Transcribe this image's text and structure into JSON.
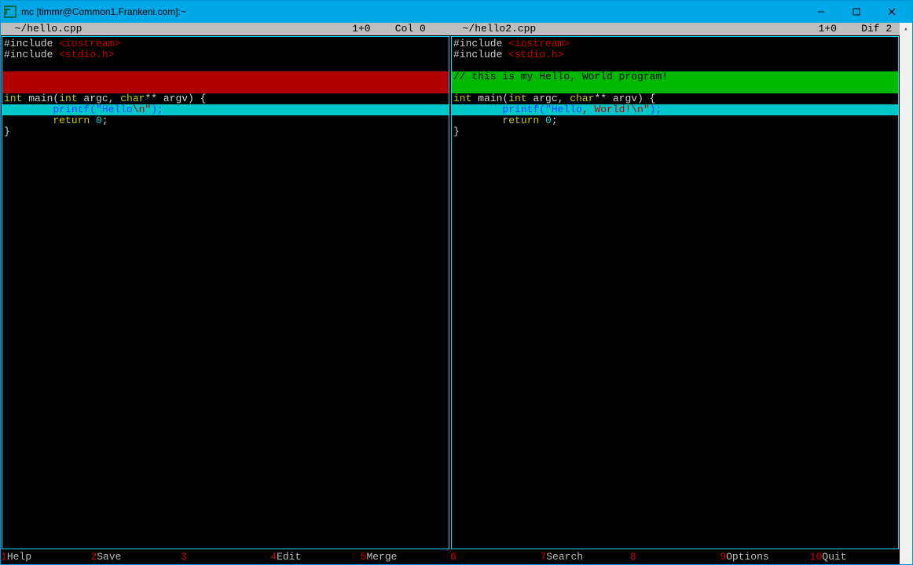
{
  "window": {
    "title": "mc [timmr@Common1.Frankeni.com]:~"
  },
  "status": {
    "left": {
      "filename": "~/hello.cpp",
      "pos": "1+0",
      "col": "Col 0"
    },
    "right": {
      "filename": "~/hello2.cpp",
      "pos": "1+0",
      "dif": "Dif 2"
    }
  },
  "pane_left": {
    "lines": [
      {
        "cls": "",
        "segs": [
          {
            "t": "#include ",
            "c": "tok-white"
          },
          {
            "t": "<iostream>",
            "c": "tok-red"
          }
        ]
      },
      {
        "cls": "",
        "segs": [
          {
            "t": "#include ",
            "c": "tok-white"
          },
          {
            "t": "<stdio.h>",
            "c": "tok-red"
          }
        ]
      },
      {
        "cls": "",
        "segs": [
          {
            "t": "",
            "c": ""
          }
        ]
      },
      {
        "cls": "diff-red",
        "segs": [
          {
            "t": " ",
            "c": ""
          }
        ]
      },
      {
        "cls": "diff-red",
        "segs": [
          {
            "t": " ",
            "c": ""
          }
        ]
      },
      {
        "cls": "",
        "segs": [
          {
            "t": "int",
            "c": "tok-yellow"
          },
          {
            "t": " main(",
            "c": "tok-white"
          },
          {
            "t": "int",
            "c": "tok-yellow"
          },
          {
            "t": " argc, ",
            "c": "tok-white"
          },
          {
            "t": "char",
            "c": "tok-yellow"
          },
          {
            "t": "** argv) {",
            "c": "tok-white"
          }
        ]
      },
      {
        "cls": "diff-cyan",
        "segs": [
          {
            "t": "        printf(",
            "c": "tok-blue"
          },
          {
            "t": "\"Hello",
            "c": "tok-blue"
          },
          {
            "t": "\\n\"",
            "c": "tok-red"
          },
          {
            "t": ");",
            "c": "tok-blue"
          }
        ]
      },
      {
        "cls": "",
        "segs": [
          {
            "t": "        ",
            "c": ""
          },
          {
            "t": "return",
            "c": "tok-yellow"
          },
          {
            "t": " ",
            "c": ""
          },
          {
            "t": "0",
            "c": "tok-cyan"
          },
          {
            "t": ";",
            "c": "tok-white"
          }
        ]
      },
      {
        "cls": "",
        "segs": [
          {
            "t": "}",
            "c": "tok-white"
          }
        ]
      }
    ]
  },
  "pane_right": {
    "lines": [
      {
        "cls": "",
        "segs": [
          {
            "t": "#include ",
            "c": "tok-white"
          },
          {
            "t": "<iostream>",
            "c": "tok-red"
          }
        ]
      },
      {
        "cls": "",
        "segs": [
          {
            "t": "#include ",
            "c": "tok-white"
          },
          {
            "t": "<stdio.h>",
            "c": "tok-red"
          }
        ]
      },
      {
        "cls": "",
        "segs": [
          {
            "t": "",
            "c": ""
          }
        ]
      },
      {
        "cls": "diff-green",
        "segs": [
          {
            "t": "// this is my Hello, World program!",
            "c": "tok-black"
          }
        ]
      },
      {
        "cls": "diff-green",
        "segs": [
          {
            "t": " ",
            "c": ""
          }
        ]
      },
      {
        "cls": "",
        "segs": [
          {
            "t": "int",
            "c": "tok-yellow"
          },
          {
            "t": " main(",
            "c": "tok-white"
          },
          {
            "t": "int",
            "c": "tok-yellow"
          },
          {
            "t": " argc, ",
            "c": "tok-white"
          },
          {
            "t": "char",
            "c": "tok-yellow"
          },
          {
            "t": "** argv) {",
            "c": "tok-white"
          }
        ]
      },
      {
        "cls": "diff-cyan",
        "segs": [
          {
            "t": "        printf(",
            "c": "tok-blue"
          },
          {
            "t": "\"Hello",
            "c": "tok-blue"
          },
          {
            "t": ", World!",
            "c": "tok-red"
          },
          {
            "t": "\\n\"",
            "c": "tok-red"
          },
          {
            "t": ");",
            "c": "tok-blue"
          }
        ]
      },
      {
        "cls": "",
        "segs": [
          {
            "t": "        ",
            "c": ""
          },
          {
            "t": "return",
            "c": "tok-yellow"
          },
          {
            "t": " ",
            "c": ""
          },
          {
            "t": "0",
            "c": "tok-cyan"
          },
          {
            "t": ";",
            "c": "tok-white"
          }
        ]
      },
      {
        "cls": "",
        "segs": [
          {
            "t": "}",
            "c": "tok-white"
          }
        ]
      }
    ]
  },
  "fkeys": [
    {
      "n": "1",
      "label": "Help"
    },
    {
      "n": "2",
      "label": "Save"
    },
    {
      "n": "3",
      "label": ""
    },
    {
      "n": "4",
      "label": "Edit"
    },
    {
      "n": "5",
      "label": "Merge"
    },
    {
      "n": "6",
      "label": ""
    },
    {
      "n": "7",
      "label": "Search"
    },
    {
      "n": "8",
      "label": ""
    },
    {
      "n": "9",
      "label": "Options"
    },
    {
      "n": "10",
      "label": "Quit"
    }
  ]
}
